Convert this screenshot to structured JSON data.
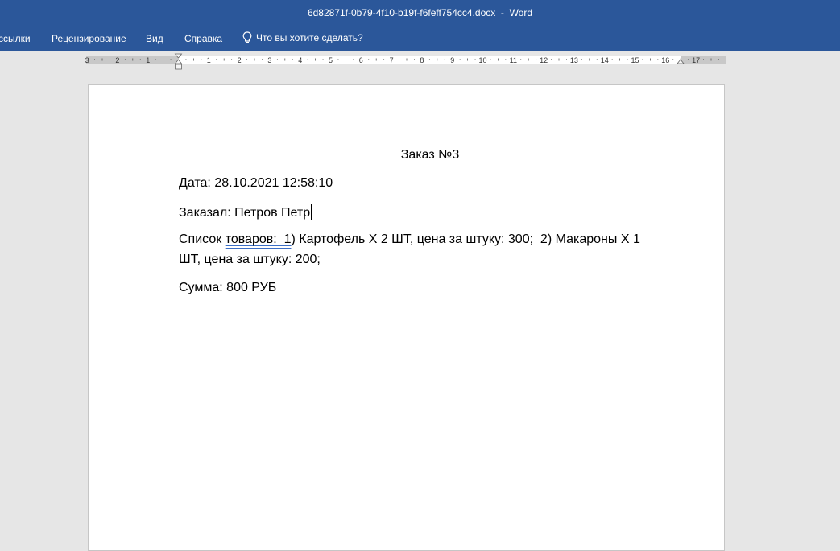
{
  "window": {
    "title": "6d82871f-0b79-4f10-b19f-f6feff754cc4.docx  -  Word"
  },
  "ribbon": {
    "tabs": [
      {
        "label": "ссылки"
      },
      {
        "label": "Рецензирование"
      },
      {
        "label": "Вид"
      },
      {
        "label": "Справка"
      }
    ],
    "tell_me": "Что вы хотите сделать?",
    "tell_me_icon": "lightbulb-icon"
  },
  "ruler": {
    "labels_left": [
      "3",
      "2",
      "1"
    ],
    "labels_right": [
      "1",
      "2",
      "3",
      "4",
      "5",
      "6",
      "7",
      "8",
      "9",
      "10",
      "11",
      "12",
      "13",
      "14",
      "15",
      "16",
      "17"
    ]
  },
  "document": {
    "title": "Заказ №3",
    "date_line": "Дата: 28.10.2021 12:58:10",
    "customer_line": "Заказал: Петров Петр",
    "items_line_1_a": "Список ",
    "items_line_1_b": "товаров:  1",
    "items_line_1_c": ") Картофель Х 2 ШТ, цена за штуку: 300;  2) Макароны Х 1",
    "items_line_2": "ШТ, цена за штуку: 200;",
    "sum_line": "Сумма: 800 РУБ"
  },
  "colors": {
    "titlebar": "#2b579a",
    "workspace": "#e6e6e6",
    "page": "#ffffff"
  }
}
